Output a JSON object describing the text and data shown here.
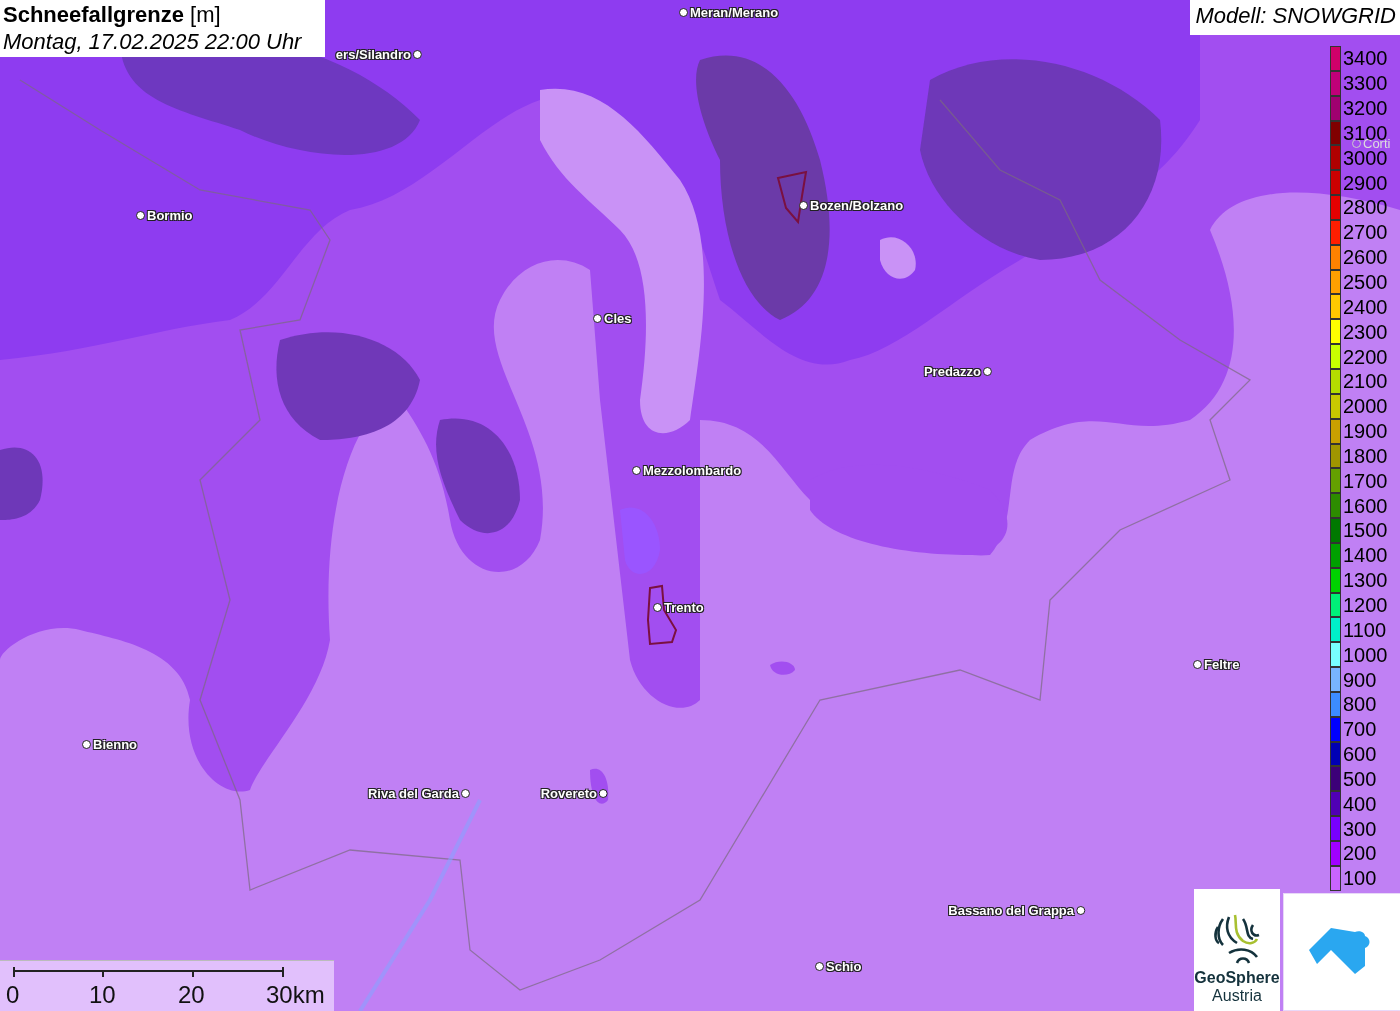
{
  "title": {
    "parameter": "Schneefallgrenze",
    "unit": "[m]",
    "time": "Montag, 17.02.2025 22:00 Uhr"
  },
  "model": "Modell: SNOWGRID",
  "cities": [
    {
      "name": "Meran/Merano"
    },
    {
      "name": "ers/Silandro"
    },
    {
      "name": "Bormio"
    },
    {
      "name": "Bozen/Bolzano"
    },
    {
      "name": "Cles"
    },
    {
      "name": "Predazzo"
    },
    {
      "name": "Mezzolombardo"
    },
    {
      "name": "Trento"
    },
    {
      "name": "Feltre"
    },
    {
      "name": "Bienno"
    },
    {
      "name": "Riva del Garda"
    },
    {
      "name": "Rovereto"
    },
    {
      "name": "Bassano del Grappa"
    },
    {
      "name": "Schio"
    },
    {
      "name": "Corti"
    }
  ],
  "legend": [
    {
      "label": "3400",
      "color": "#d0006a"
    },
    {
      "label": "3300",
      "color": "#c00078"
    },
    {
      "label": "3200",
      "color": "#a00070"
    },
    {
      "label": "3100",
      "color": "#800000"
    },
    {
      "label": "3000",
      "color": "#b00000"
    },
    {
      "label": "2900",
      "color": "#cc0000"
    },
    {
      "label": "2800",
      "color": "#e60000"
    },
    {
      "label": "2700",
      "color": "#ff1e00"
    },
    {
      "label": "2600",
      "color": "#ff8200"
    },
    {
      "label": "2500",
      "color": "#ffa000"
    },
    {
      "label": "2400",
      "color": "#ffc800"
    },
    {
      "label": "2300",
      "color": "#ffff00"
    },
    {
      "label": "2200",
      "color": "#c8ff00"
    },
    {
      "label": "2100",
      "color": "#b4dc00"
    },
    {
      "label": "2000",
      "color": "#c8c800"
    },
    {
      "label": "1900",
      "color": "#c8a000"
    },
    {
      "label": "1800",
      "color": "#a09600"
    },
    {
      "label": "1700",
      "color": "#64a000"
    },
    {
      "label": "1600",
      "color": "#2d8c00"
    },
    {
      "label": "1500",
      "color": "#007800"
    },
    {
      "label": "1400",
      "color": "#00a000"
    },
    {
      "label": "1300",
      "color": "#00d200"
    },
    {
      "label": "1200",
      "color": "#00f078"
    },
    {
      "label": "1100",
      "color": "#00f0c8"
    },
    {
      "label": "1000",
      "color": "#78ffff"
    },
    {
      "label": "900",
      "color": "#78b4ff"
    },
    {
      "label": "800",
      "color": "#3c8cff"
    },
    {
      "label": "700",
      "color": "#0000ff"
    },
    {
      "label": "600",
      "color": "#0000b4"
    },
    {
      "label": "500",
      "color": "#3c0078"
    },
    {
      "label": "400",
      "color": "#5000b4"
    },
    {
      "label": "300",
      "color": "#7800ff"
    },
    {
      "label": "200",
      "color": "#a000ff"
    },
    {
      "label": "100",
      "color": "#c864ff"
    }
  ],
  "scale": {
    "ticks": [
      "0",
      "10",
      "20",
      "30km"
    ]
  },
  "logo": {
    "line1": "GeoSphere",
    "line2": "Austria"
  }
}
